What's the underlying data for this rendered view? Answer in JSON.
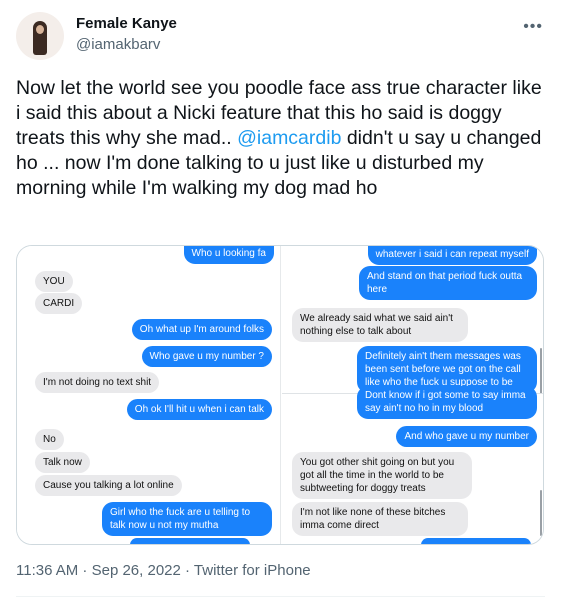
{
  "author": {
    "name": "Female Kanye",
    "handle": "@iamakbarv"
  },
  "icons": {
    "more": "more-horizontal-icon",
    "avatar": "avatar-photo"
  },
  "tweet": {
    "text_before": "Now let the world see you poodle face ass true character like i said this about a Nicki feature that this ho said is doggy treats this why she mad.. ",
    "mention": "@iamcardib",
    "text_after": " didn't u say u changed ho ... now I'm done talking to u just like u disturbed my morning while I'm walking my dog mad ho"
  },
  "media": {
    "left_pane": [
      {
        "text": "Who u looking fa",
        "from": "me"
      },
      {
        "text": "YOU",
        "from": "them"
      },
      {
        "text": "CARDI",
        "from": "them"
      },
      {
        "text": "Oh what up I'm around folks",
        "from": "me"
      },
      {
        "text": "Who gave u my number ?",
        "from": "me"
      },
      {
        "text": "I'm not doing no text shit",
        "from": "them"
      },
      {
        "text": "Oh ok I'll hit u when i can talk",
        "from": "me"
      },
      {
        "text": "No",
        "from": "them"
      },
      {
        "text": "Talk now",
        "from": "them"
      },
      {
        "text": "Cause you talking a lot online",
        "from": "them"
      },
      {
        "text": "Girl who the fuck are u telling to talk now u not my mutha",
        "from": "me"
      }
    ],
    "right_pane": [
      {
        "text": "whatever i said i can repeat myself",
        "from": "me"
      },
      {
        "text": "And stand on that period fuck outta here",
        "from": "me"
      },
      {
        "text": "We already said what we said ain't nothing else to talk about",
        "from": "them"
      },
      {
        "text": "Definitely ain't them messages was been sent before we got on the call like who the fuck u suppose to be",
        "from": "me"
      },
      {
        "text": "Dont know if i got some to say imma say ain't no ho in my blood",
        "from": "me"
      },
      {
        "text": "And who gave u my number",
        "from": "me"
      },
      {
        "text": "You got other shit going on but you got all the time in the world to be subtweeting for doggy treats",
        "from": "them"
      },
      {
        "text": "I'm not like none of these bitches imma come direct",
        "from": "them"
      }
    ]
  },
  "meta": {
    "time": "11:36 AM",
    "separator": " · ",
    "date": "Sep 26, 2022",
    "source": "Twitter for iPhone"
  },
  "colors": {
    "link": "#1d9bf0",
    "imessage_blue": "#1a82fb",
    "imessage_gray": "#e9e9eb",
    "secondary_text": "#536471"
  }
}
